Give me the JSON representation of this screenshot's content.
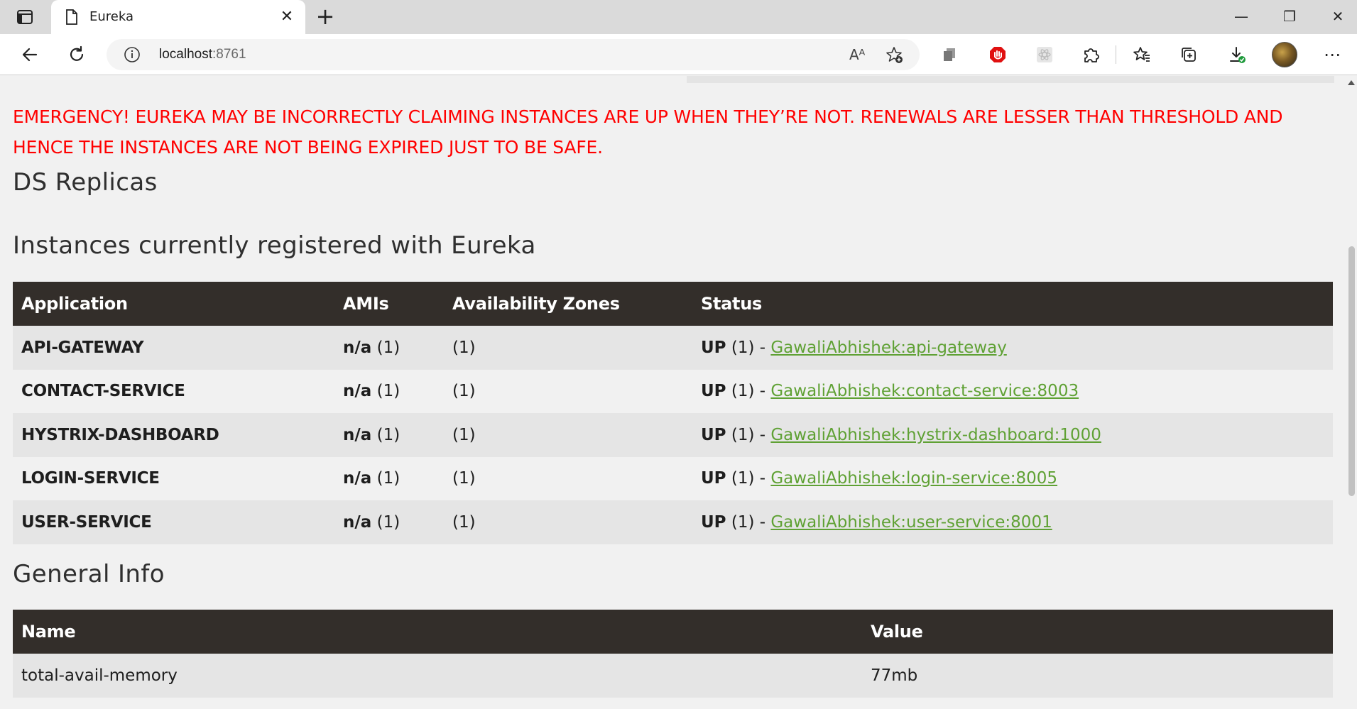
{
  "browser": {
    "tab_title": "Eureka",
    "tab_close": "✕",
    "new_tab": "+",
    "url_host": "localhost",
    "url_port": ":8761",
    "read_aloud": "Aᴬ",
    "window": {
      "minimize": "—",
      "maximize": "❐",
      "close": "✕"
    },
    "more": "⋯"
  },
  "emergency_text": "EMERGENCY! EUREKA MAY BE INCORRECTLY CLAIMING INSTANCES ARE UP WHEN THEY’RE NOT. RENEWALS ARE LESSER THAN THRESHOLD AND HENCE THE INSTANCES ARE NOT BEING EXPIRED JUST TO BE SAFE.",
  "headings": {
    "ds_replicas": "DS Replicas",
    "instances": "Instances currently registered with Eureka",
    "general_info": "General Info"
  },
  "instances_table": {
    "columns": [
      "Application",
      "AMIs",
      "Availability Zones",
      "Status"
    ],
    "rows": [
      {
        "application": "API-GATEWAY",
        "ami_label": "n/a",
        "ami_count": " (1)",
        "zones": "(1)",
        "status_label": "UP",
        "status_count": " (1) - ",
        "instance": "GawaliAbhishek:api-gateway"
      },
      {
        "application": "CONTACT-SERVICE",
        "ami_label": "n/a",
        "ami_count": " (1)",
        "zones": "(1)",
        "status_label": "UP",
        "status_count": " (1) - ",
        "instance": "GawaliAbhishek:contact-service:8003"
      },
      {
        "application": "HYSTRIX-DASHBOARD",
        "ami_label": "n/a",
        "ami_count": " (1)",
        "zones": "(1)",
        "status_label": "UP",
        "status_count": " (1) - ",
        "instance": "GawaliAbhishek:hystrix-dashboard:1000"
      },
      {
        "application": "LOGIN-SERVICE",
        "ami_label": "n/a",
        "ami_count": " (1)",
        "zones": "(1)",
        "status_label": "UP",
        "status_count": " (1) - ",
        "instance": "GawaliAbhishek:login-service:8005"
      },
      {
        "application": "USER-SERVICE",
        "ami_label": "n/a",
        "ami_count": " (1)",
        "zones": "(1)",
        "status_label": "UP",
        "status_count": " (1) - ",
        "instance": "GawaliAbhishek:user-service:8001"
      }
    ]
  },
  "general_table": {
    "columns": [
      "Name",
      "Value"
    ],
    "rows": [
      {
        "name": "total-avail-memory",
        "value": "77mb"
      }
    ]
  },
  "colors": {
    "emergency": "#ff0000",
    "table_header": "#332e2a",
    "link": "#5fa134",
    "row_odd": "#e5e5e5",
    "row_even": "#f1f1f1",
    "adblock_icon": "#e01010"
  }
}
